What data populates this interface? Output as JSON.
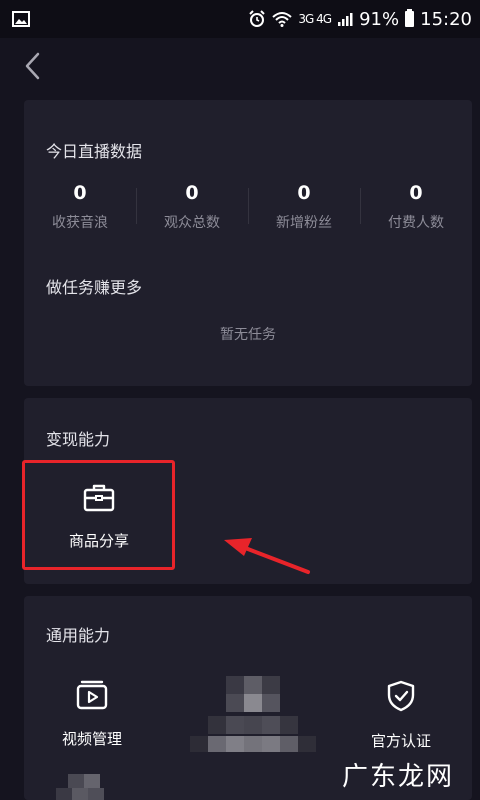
{
  "status_bar": {
    "battery": "91%",
    "time": "15:20",
    "signal_text": "3G 4G"
  },
  "live_data": {
    "title": "今日直播数据",
    "stats": [
      {
        "value": "0",
        "label": "收获音浪"
      },
      {
        "value": "0",
        "label": "观众总数"
      },
      {
        "value": "0",
        "label": "新增粉丝"
      },
      {
        "value": "0",
        "label": "付费人数"
      }
    ],
    "tasks_title": "做任务赚更多",
    "tasks_empty": "暂无任务"
  },
  "monetization": {
    "title": "变现能力",
    "item": {
      "label": "商品分享",
      "icon": "briefcase-icon"
    }
  },
  "general": {
    "title": "通用能力",
    "items": [
      {
        "label": "视频管理",
        "icon": "video-manage-icon"
      },
      {
        "label": "官方认证",
        "icon": "shield-check-icon"
      }
    ]
  },
  "watermark": "广东龙网",
  "colors": {
    "highlight": "#e8242a",
    "background": "#15141f",
    "card": "#201f2c"
  }
}
